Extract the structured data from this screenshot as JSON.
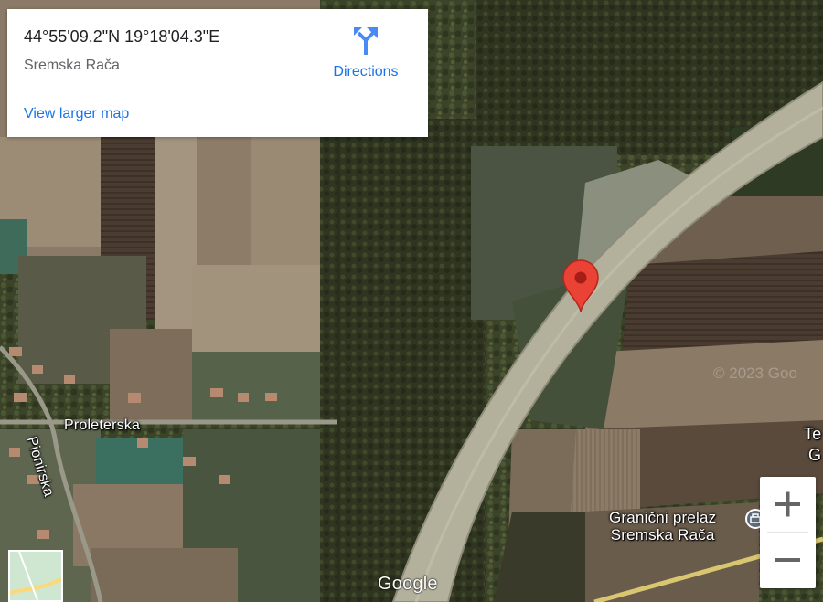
{
  "info_card": {
    "coordinates": "44°55'09.2\"N 19°18'04.3\"E",
    "place_name": "Sremska Rača",
    "directions_label": "Directions",
    "view_larger_label": "View larger map"
  },
  "map": {
    "imagery": "satellite",
    "street_labels": [
      "Proleterska",
      "Pionirska"
    ],
    "poi": {
      "line1": "Granični prelaz",
      "line2": "Sremska Rača",
      "icon": "border-crossing-icon"
    },
    "partial_label_edge": "Te",
    "partial_label_edge_2": "G",
    "marker": {
      "icon": "red-pin-icon",
      "color": "#ea4335"
    },
    "watermark": "© 2023 Goo"
  },
  "controls": {
    "zoom_in_icon": "plus-icon",
    "zoom_out_icon": "minus-icon",
    "logo": "Google"
  },
  "colors": {
    "link": "#1a73e8",
    "marker": "#ea4335",
    "text": "#202124",
    "subtext": "#5f6368"
  }
}
